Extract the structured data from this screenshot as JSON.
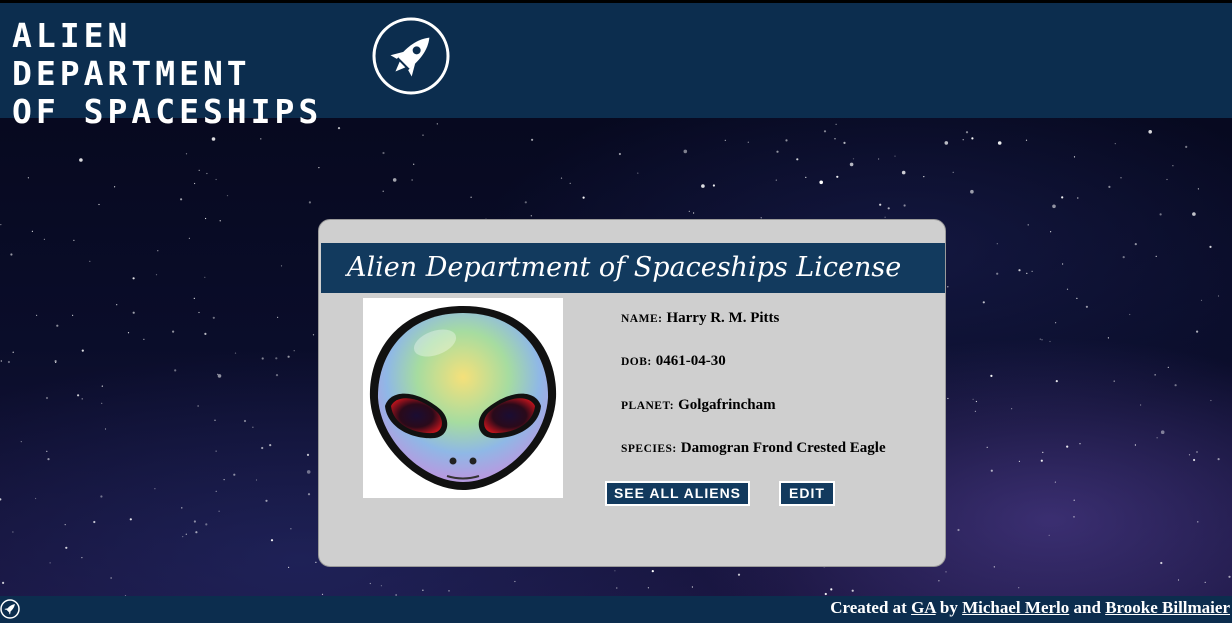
{
  "header": {
    "title_line1": "ALIEN DEPARTMENT",
    "title_line2": "OF SPACESHIPS",
    "logo_icon": "rocket-icon"
  },
  "license": {
    "title": "Alien Department of Spaceships License",
    "photo_icon": "alien-head-image",
    "fields": [
      {
        "label": "NAME:",
        "value": "Harry R. M. Pitts"
      },
      {
        "label": "DOB:",
        "value": "0461-04-30"
      },
      {
        "label": "PLANET:",
        "value": "Golgafrincham"
      },
      {
        "label": "SPECIES:",
        "value": "Damogran Frond Crested Eagle"
      }
    ],
    "buttons": {
      "see_all": "SEE ALL ALIENS",
      "edit": "EDIT"
    }
  },
  "footer": {
    "icon": "rocket-icon",
    "created_at": "Created at",
    "org_link": "GA",
    "by": "by",
    "author1": "Michael Merlo",
    "and": "and",
    "author2": "Brooke Billmaier"
  },
  "colors": {
    "navy": "#0c2d4e",
    "card_header": "#123a5e",
    "card_bg": "#cfcfcf"
  }
}
